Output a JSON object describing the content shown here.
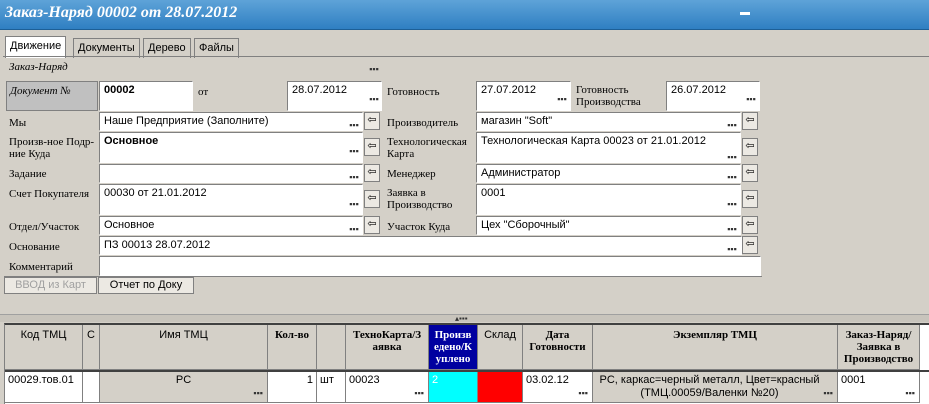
{
  "window": {
    "title": "Заказ-Наряд 00002 от 28.07.2012"
  },
  "tabs": [
    {
      "label": "Движение",
      "active": true
    },
    {
      "label": "Документы",
      "active": false
    },
    {
      "label": "Дерево",
      "active": false
    },
    {
      "label": "Файлы",
      "active": false
    }
  ],
  "section_label": "Заказ-Наряд",
  "doc": {
    "number_label": "Документ №",
    "number": "00002",
    "date_label": "от",
    "date": "28.07.2012",
    "ready_label": "Готовность",
    "ready_date": "27.07.2012",
    "prod_ready_label": "Готовность Производства",
    "prod_ready_date": "26.07.2012"
  },
  "form": {
    "we_label": "Мы",
    "we_value": "Наше Предприятие (Заполните)",
    "subdiv_label": "Произв-ное Подр-ние Куда",
    "subdiv_value": "Основное",
    "task_label": "Задание",
    "task_value": "",
    "invoice_label": "Счет Покупателя",
    "invoice_value": "00030 от 21.01.2012",
    "dept_label": "Отдел/Участок",
    "dept_value": "Основное",
    "basis_label": "Основание",
    "basis_value": "ПЗ 00013 28.07.2012",
    "comment_label": "Комментарий",
    "comment_value": "",
    "maker_label": "Производитель",
    "maker_value": "магазин \"Soft\"",
    "techcard_label": "Технологическая Карта",
    "techcard_value": "Технологическая Карта 00023 от 21.01.2012",
    "manager_label": "Менеджер",
    "manager_value": "Администратор",
    "request_label": "Заявка в Производство",
    "request_value": "0001",
    "area_label": "Участок Куда",
    "area_value": "Цех \"Сборочный\""
  },
  "buttons": {
    "input_from_card": "ВВОД из Карт",
    "report_by_doc": "Отчет по Доку"
  },
  "table": {
    "headers": {
      "code": "Код ТМЦ",
      "c": "С",
      "name": "Имя ТМЦ",
      "qty": "Кол-во",
      "techcard": "ТехноКарта/З аявка",
      "produced": "Произв едено/К уплено",
      "warehouse": "Склад",
      "ready_date": "Дата Готовности",
      "instance": "Экземпляр ТМЦ",
      "order": "Заказ-Наряд/ Заявка в Производство"
    },
    "rows": [
      {
        "code": "00029.тов.01",
        "c": "",
        "name": "PC",
        "qty": "1",
        "unit": "шт",
        "techcard": "00023",
        "produced": "2",
        "warehouse": "",
        "ready_date": "03.02.12",
        "instance": "PC, каркас=черный металл, Цвет=красный (ТМЦ.00059/Валенки №20)",
        "order": "0001"
      }
    ]
  },
  "colors": {
    "title_bar": "#3b8bd0",
    "produced_cell": "#00ffff",
    "warehouse_cell": "#ff0000",
    "produced_header": "#0000a0"
  }
}
